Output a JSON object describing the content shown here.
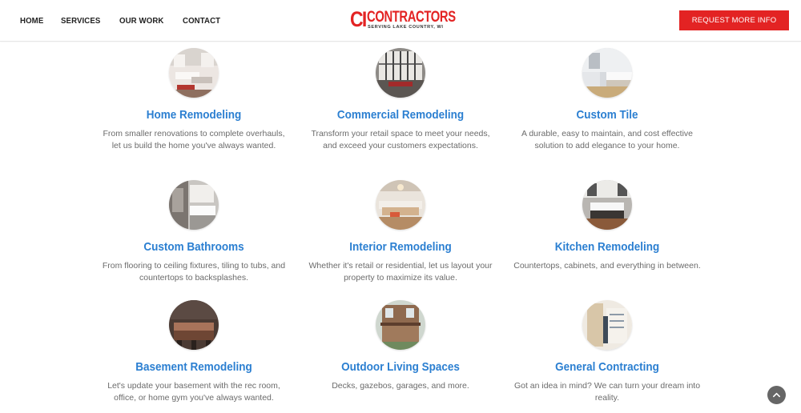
{
  "nav": {
    "items": [
      "HOME",
      "SERVICES",
      "OUR WORK",
      "CONTACT"
    ]
  },
  "logo": {
    "mark": "CI",
    "word": "CONTRACTORS",
    "tagline": "SERVING LAKE COUNTRY, WI"
  },
  "cta": {
    "label": "REQUEST MORE INFO"
  },
  "colors": {
    "accent": "#e32323",
    "heading": "#2b7fd1",
    "body_text": "#6b6b6b"
  },
  "services": [
    {
      "title": "Home Remodeling",
      "desc": "From smaller renovations to complete overhauls, let us build the home you've always wanted.",
      "icon": "living-room-photo"
    },
    {
      "title": "Commercial Remodeling",
      "desc": "Transform your retail space to meet your needs, and exceed your customers expectations.",
      "icon": "commercial-interior-photo"
    },
    {
      "title": "Custom Tile",
      "desc": "A durable, easy to maintain, and cost effective solution to add elegance to your home.",
      "icon": "tiled-kitchen-photo"
    },
    {
      "title": "Custom Bathrooms",
      "desc": "From flooring to ceiling fixtures, tiling to tubs, and countertops to backsplashes.",
      "icon": "bathroom-photo"
    },
    {
      "title": "Interior Remodeling",
      "desc": "Whether it's retail or residential, let us layout your property to maximize its value.",
      "icon": "interior-lounge-photo"
    },
    {
      "title": "Kitchen Remodeling",
      "desc": "Countertops, cabinets, and everything in between.",
      "icon": "kitchen-photo"
    },
    {
      "title": "Basement Remodeling",
      "desc": "Let's update your basement with the rec room, office, or home gym you've always wanted.",
      "icon": "basement-bar-photo"
    },
    {
      "title": "Outdoor Living Spaces",
      "desc": "Decks, gazebos, garages, and more.",
      "icon": "deck-photo"
    },
    {
      "title": "General Contracting",
      "desc": "Got an idea in mind? We can turn your dream into reality.",
      "icon": "blueprints-photo"
    }
  ],
  "scroll_top": {
    "icon": "chevron-up-icon"
  }
}
